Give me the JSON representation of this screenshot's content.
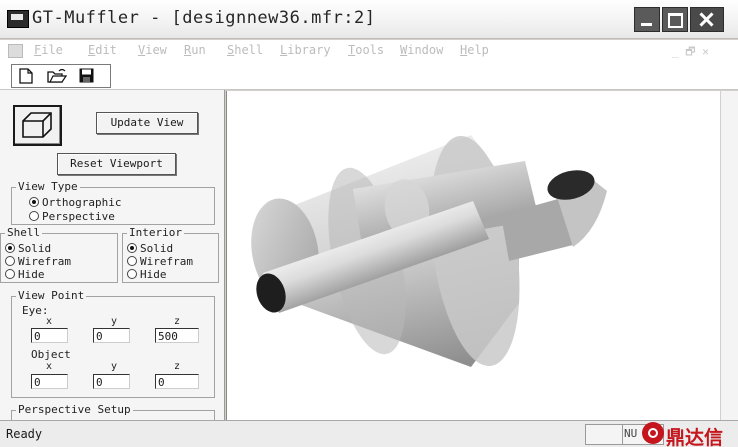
{
  "window": {
    "title": "GT-Muffler - [designnew36.mfr:2]"
  },
  "menu": {
    "items": [
      {
        "mnemonic": "F",
        "rest": "ile"
      },
      {
        "mnemonic": "E",
        "rest": "dit"
      },
      {
        "mnemonic": "V",
        "rest": "iew"
      },
      {
        "mnemonic": "R",
        "rest": "un"
      },
      {
        "mnemonic": "S",
        "rest": "hell"
      },
      {
        "mnemonic": "L",
        "rest": "ibrary"
      },
      {
        "mnemonic": "T",
        "rest": "ools"
      },
      {
        "mnemonic": "W",
        "rest": "indow"
      },
      {
        "mnemonic": "H",
        "rest": "elp"
      }
    ],
    "mdi_controls": "_ 🗗 ✕"
  },
  "toolbar": {
    "icons": [
      "new-file-icon",
      "open-folder-icon",
      "save-disk-icon"
    ]
  },
  "panel": {
    "update_view": "Update View",
    "reset_viewport": "Reset Viewport",
    "view_type": {
      "legend": "View Type",
      "options": [
        "Orthographic",
        "Perspective"
      ],
      "selected": "Orthographic"
    },
    "shell": {
      "legend": "Shell",
      "options": [
        "Solid",
        "Wirefram",
        "Hide"
      ],
      "selected": "Solid"
    },
    "interior": {
      "legend": "Interior",
      "options": [
        "Solid",
        "Wirefram",
        "Hide"
      ],
      "selected": "Solid"
    },
    "view_point": {
      "legend": "View Point",
      "eye_label": "Eye:",
      "object_label": "Object",
      "axis_labels": [
        "x",
        "y",
        "z"
      ],
      "eye": [
        "0",
        "0",
        "500"
      ],
      "object": [
        "0",
        "0",
        "0"
      ]
    },
    "perspective_setup": {
      "legend": "Perspective Setup"
    }
  },
  "status": {
    "text": "Ready",
    "num": "NU"
  },
  "watermark": {
    "text": "鼎达信"
  },
  "colors": {
    "title_close_bg": "#4a4a4a",
    "watermark_red": "#c4161c"
  }
}
